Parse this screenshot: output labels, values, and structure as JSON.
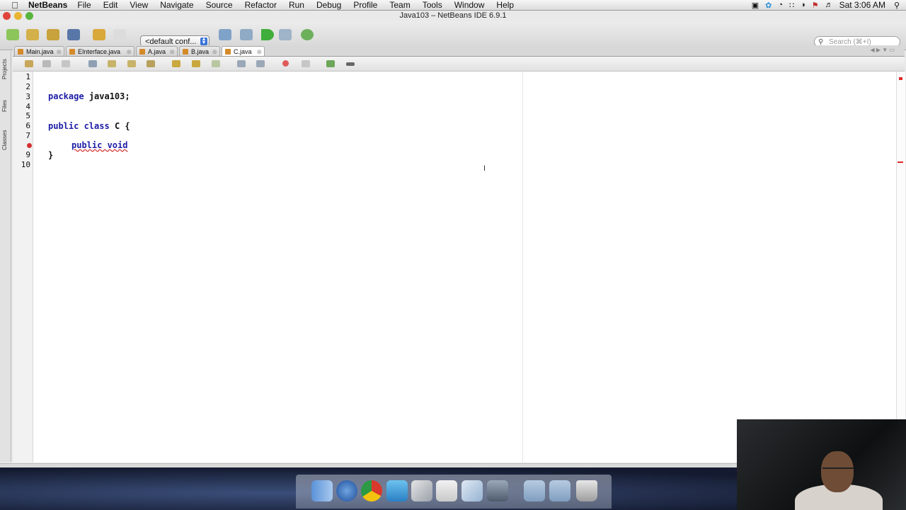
{
  "menubar": {
    "app_name": "NetBeans",
    "items": [
      "File",
      "Edit",
      "View",
      "Navigate",
      "Source",
      "Refactor",
      "Run",
      "Debug",
      "Profile",
      "Team",
      "Tools",
      "Window",
      "Help"
    ],
    "clock": "Sat 3:06 AM"
  },
  "window": {
    "title": "Java103 – NetBeans IDE 6.9.1"
  },
  "toolbar": {
    "config_value": "<default conf...",
    "search_placeholder": "Search (⌘+I)"
  },
  "sidebar": {
    "tabs": [
      "Projects",
      "Files",
      "Classes"
    ]
  },
  "editor_tabs": [
    {
      "label": "Main.java"
    },
    {
      "label": "EInterface.java"
    },
    {
      "label": "A.java"
    },
    {
      "label": "B.java"
    },
    {
      "label": "C.java",
      "active": true
    }
  ],
  "editor": {
    "line_numbers": [
      "1",
      "2",
      "3",
      "4",
      "5",
      "6",
      "7",
      "",
      "9",
      "10"
    ],
    "lines": {
      "l3_kw": "package",
      "l3_rest": " java103;",
      "l6_kw1": "public",
      "l6_kw2": " class",
      "l6_rest": " C {",
      "l8_text": "public void",
      "l9_text": "}"
    },
    "error_line": 8
  },
  "colors": {
    "keyword": "#1d1da6",
    "error": "#d23232",
    "desktop": "#1a2238"
  }
}
